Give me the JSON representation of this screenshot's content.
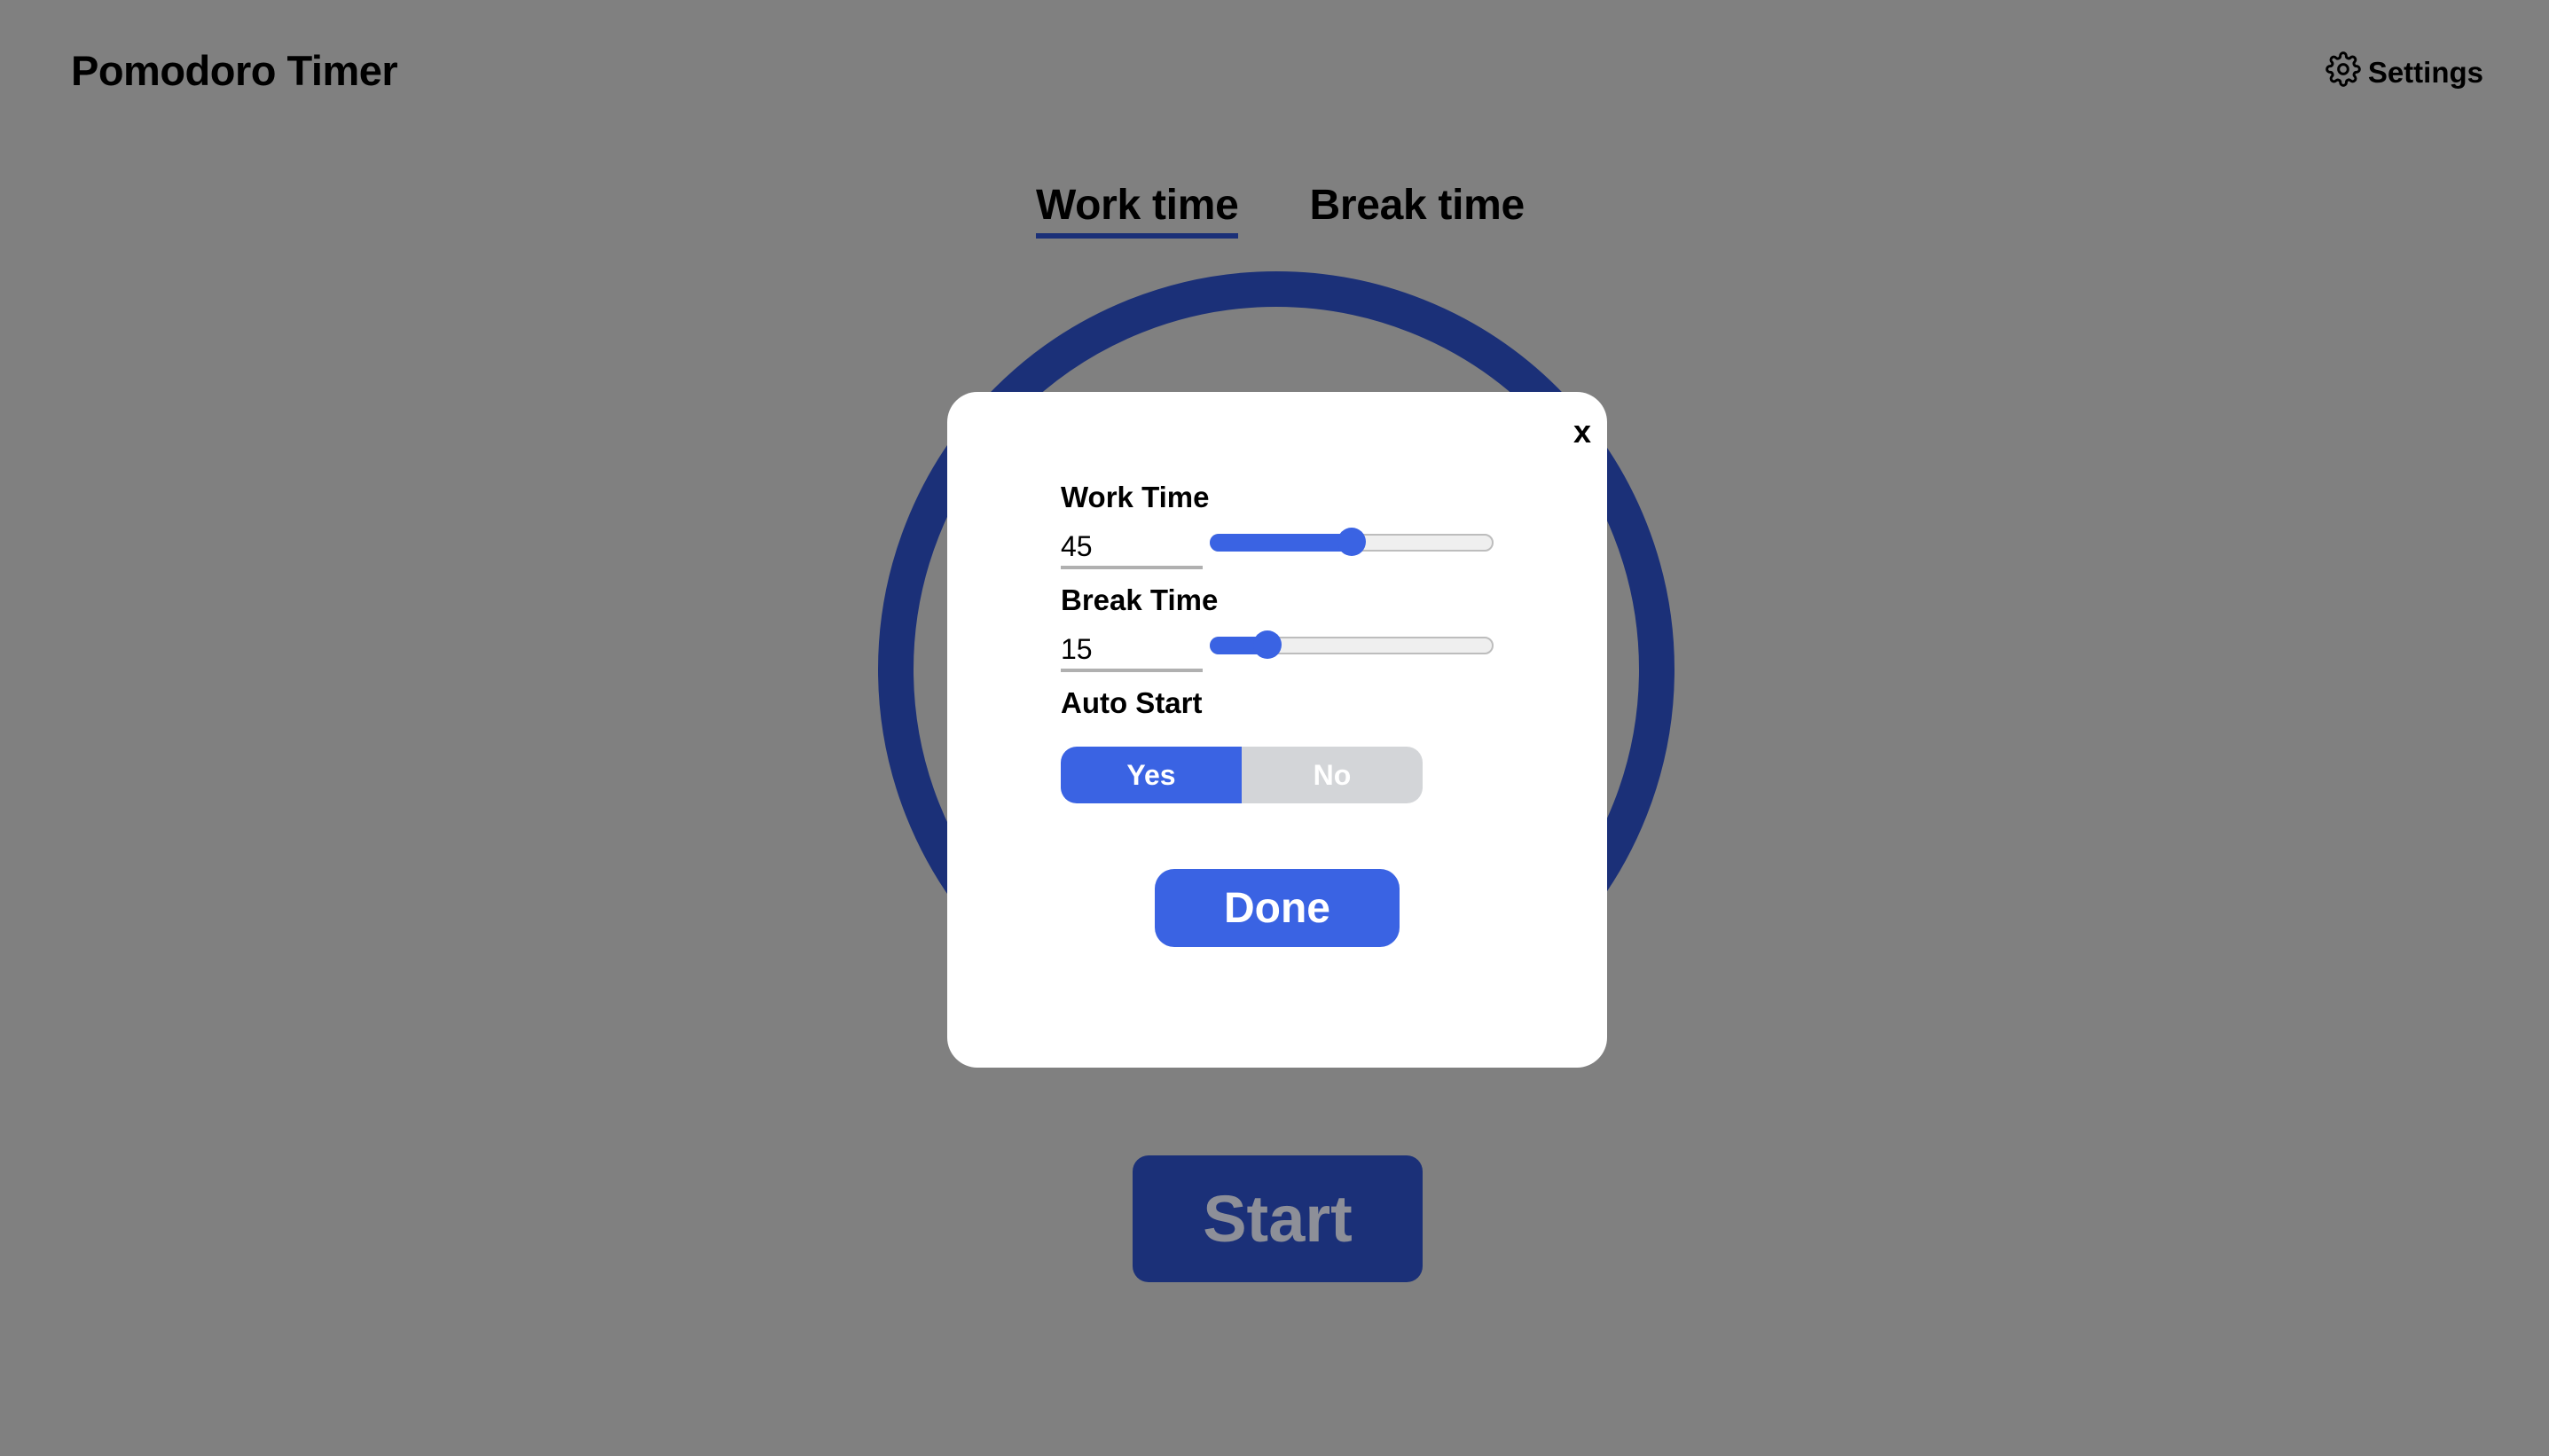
{
  "app": {
    "title": "Pomodoro Timer",
    "settings_label": "Settings",
    "settings_icon": "gear-icon"
  },
  "tabs": [
    {
      "label": "Work time",
      "active": true
    },
    {
      "label": "Break time",
      "active": false
    }
  ],
  "start_label": "Start",
  "modal": {
    "close_label": "x",
    "work": {
      "label": "Work Time",
      "value": "45",
      "slider_fraction": 0.5
    },
    "break": {
      "label": "Break Time",
      "value": "15",
      "slider_fraction": 0.2
    },
    "auto_start": {
      "label": "Auto Start",
      "options": [
        "Yes",
        "No"
      ],
      "selected": "Yes"
    },
    "done_label": "Done"
  },
  "colors": {
    "accent": "#3a63e3",
    "ring": "#1b3078",
    "overlay_bg": "#808080"
  }
}
